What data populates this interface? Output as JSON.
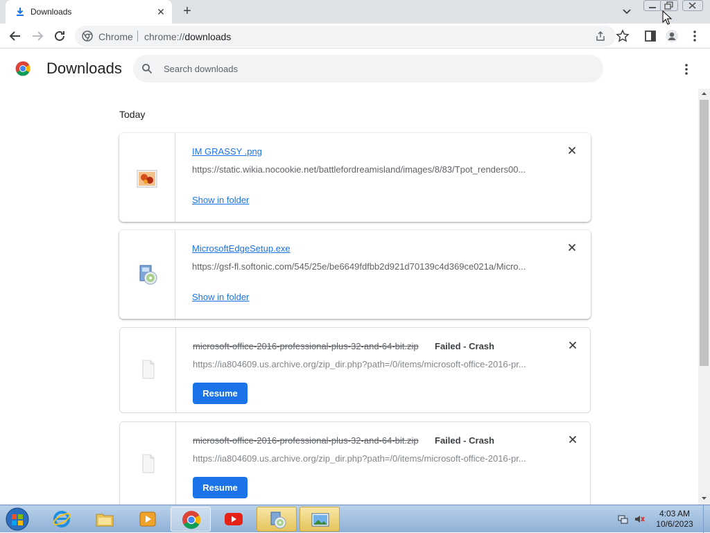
{
  "browser": {
    "tab": {
      "title": "Downloads",
      "close_label": "✕"
    },
    "new_tab_label": "+",
    "omnibox": {
      "scheme_label": "Chrome",
      "url_prefix": "chrome://",
      "url_path": "downloads"
    }
  },
  "page": {
    "title": "Downloads",
    "search": {
      "placeholder": "Search downloads",
      "value": ""
    },
    "section_label": "Today",
    "accent_color": "#1a73e8"
  },
  "downloads": [
    {
      "name": "IM GRASSY .png",
      "url": "https://static.wikia.nocookie.net/battlefordreamisland/images/8/83/Tpot_renders00...",
      "action_label": "Show in folder",
      "status": "",
      "icon": "image-file-icon"
    },
    {
      "name": "MicrosoftEdgeSetup.exe",
      "url": "https://gsf-fl.softonic.com/545/25e/be6649fdfbb2d921d70139c4d369ce021a/Micro...",
      "action_label": "Show in folder",
      "status": "",
      "icon": "installer-file-icon"
    },
    {
      "name": "microsoft-office-2016-professional-plus-32-and-64-bit.zip",
      "url": "https://ia804609.us.archive.org/zip_dir.php?path=/0/items/microsoft-office-2016-pr...",
      "action_label": "Resume",
      "status": "Failed - Crash",
      "icon": "generic-file-icon"
    },
    {
      "name": "microsoft-office-2016-professional-plus-32-and-64-bit.zip",
      "url": "https://ia804609.us.archive.org/zip_dir.php?path=/0/items/microsoft-office-2016-pr...",
      "action_label": "Resume",
      "status": "Failed - Crash",
      "icon": "generic-file-icon"
    }
  ],
  "taskbar": {
    "apps": [
      "internet-explorer",
      "windows-explorer",
      "media-player",
      "google-chrome",
      "youtube",
      "installer",
      "photo-viewer"
    ],
    "clock": {
      "time": "4:03 AM",
      "date": "10/6/2023"
    }
  }
}
